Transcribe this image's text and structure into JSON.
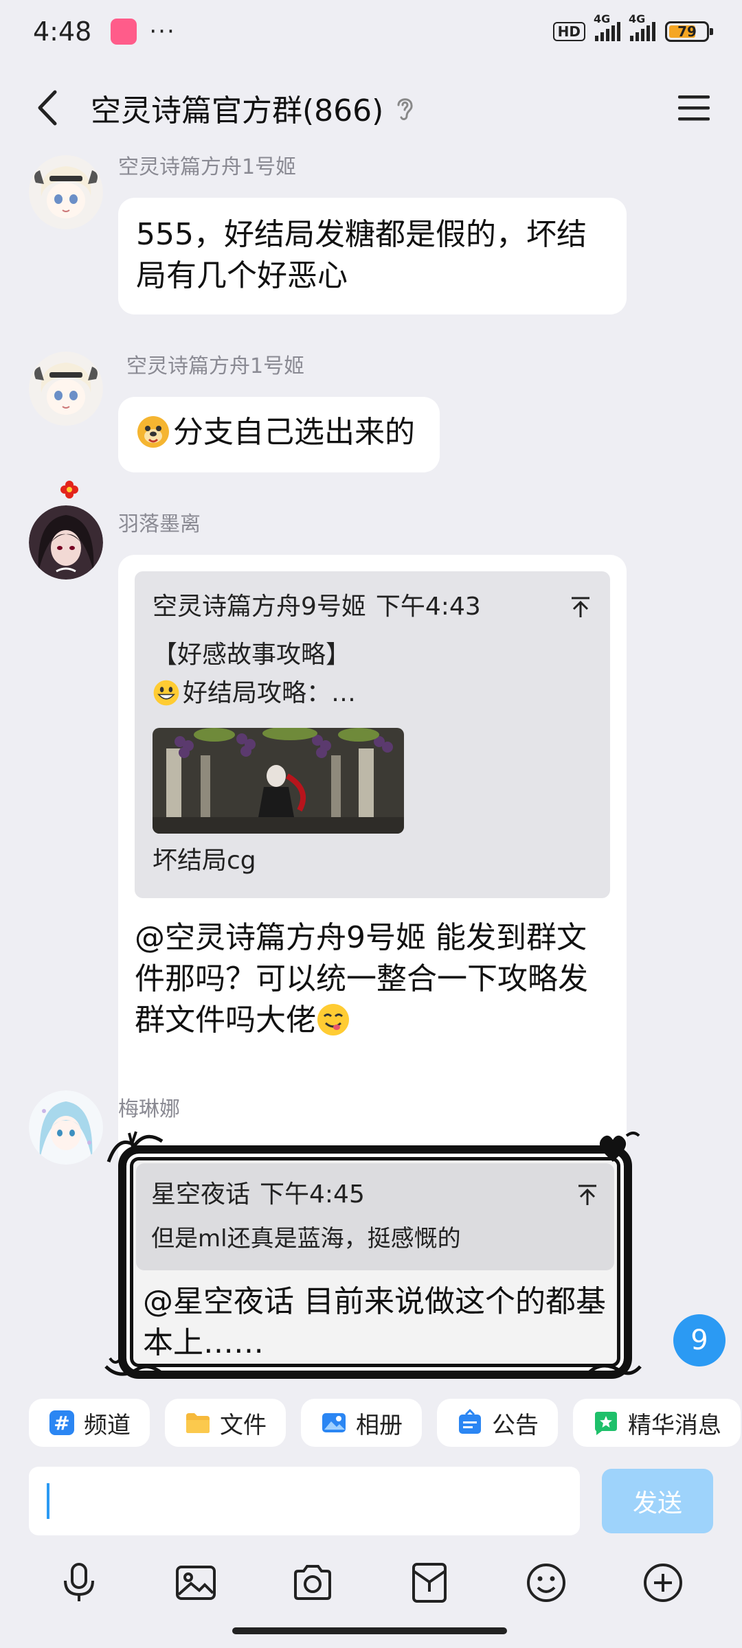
{
  "status_bar": {
    "time": "4:48",
    "app_badge": "bilibili",
    "dots": "···",
    "hd": "HD",
    "net1": "4G",
    "net2": "4G",
    "battery": "79"
  },
  "header": {
    "title": "空灵诗篇官方群(866)"
  },
  "messages": [
    {
      "sender": "空灵诗篇方舟1号姬",
      "text": "555，好结局发糖都是假的，坏结局有几个好恶心"
    },
    {
      "sender": "空灵诗篇方舟1号姬",
      "text": "分支自己选出来的"
    },
    {
      "sender": "羽落墨离",
      "quote": {
        "author": "空灵诗篇方舟9号姬",
        "time": "下午4:43",
        "line1": "【好感故事攻略】",
        "line2": "好结局攻略：…",
        "caption": "坏结局cg"
      },
      "text": "@空灵诗篇方舟9号姬 能发到群文件那吗？可以统一整合一下攻略发群文件吗大佬"
    },
    {
      "sender": "梅琳娜",
      "quote": {
        "author": "星空夜话",
        "time": "下午4:45",
        "line1": "但是ml还真是蓝海，挺感慨的"
      },
      "text": "@星空夜话 目前来说做这个的都基本上……"
    }
  ],
  "unread_count": "9",
  "quick_chips": [
    "频道",
    "文件",
    "相册",
    "公告",
    "精华消息"
  ],
  "input": {
    "value": "",
    "send_label": "发送"
  },
  "toolbar": [
    "microphone-icon",
    "image-icon",
    "camera-icon",
    "redpacket-icon",
    "emoji-icon",
    "plus-icon"
  ],
  "colors": {
    "accent": "#2b9af3",
    "send_disabled": "#9ed3fb",
    "background": "#eeeef3"
  }
}
